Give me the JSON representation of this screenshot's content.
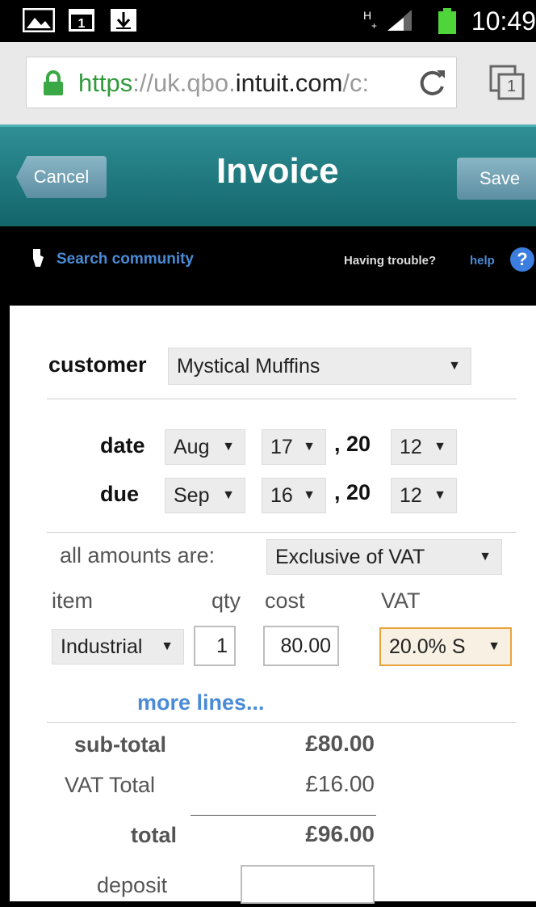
{
  "status_bar": {
    "time": "10:49",
    "icons": [
      "gallery-icon",
      "calendar-icon",
      "download-icon",
      "network-hplus-icon",
      "signal-icon",
      "battery-icon"
    ]
  },
  "browser": {
    "url_proto": "https",
    "url_sep": "://uk.qbo.",
    "url_host": "intuit.com",
    "url_rest": "/c:",
    "tab_count": "1"
  },
  "header": {
    "cancel_label": "Cancel",
    "title": "Invoice",
    "save_label": "Save"
  },
  "toolbar": {
    "search_community": "Search community",
    "trouble_text": "Having trouble?",
    "help_link": "help"
  },
  "form": {
    "customer_label": "customer",
    "customer_value": "Mystical Muffins",
    "date_label": "date",
    "date_month": "Aug",
    "date_day": "17",
    "date_century": ", 20",
    "date_year": "12",
    "due_label": "due",
    "due_month": "Sep",
    "due_day": "16",
    "due_century": ", 20",
    "due_year": "12",
    "amounts_label": "all amounts are:",
    "amounts_value": "Exclusive of VAT",
    "col_item": "item",
    "col_qty": "qty",
    "col_cost": "cost",
    "col_vat": "VAT",
    "line_item": "Industrial",
    "line_qty": "1",
    "line_cost": "80.00",
    "line_vat": "20.0% S",
    "more_lines": "more lines...",
    "subtotal_label": "sub-total",
    "subtotal_value": "£80.00",
    "vat_total_label": "VAT Total",
    "vat_total_value": "£16.00",
    "total_label": "total",
    "total_value": "£96.00",
    "deposit_label": "deposit",
    "deposit_value": ""
  },
  "colors": {
    "header_teal": "#1f7d83",
    "link_blue": "#4a8bd6",
    "url_green": "#2f9a3b",
    "vat_highlight": "#e8a33c"
  }
}
